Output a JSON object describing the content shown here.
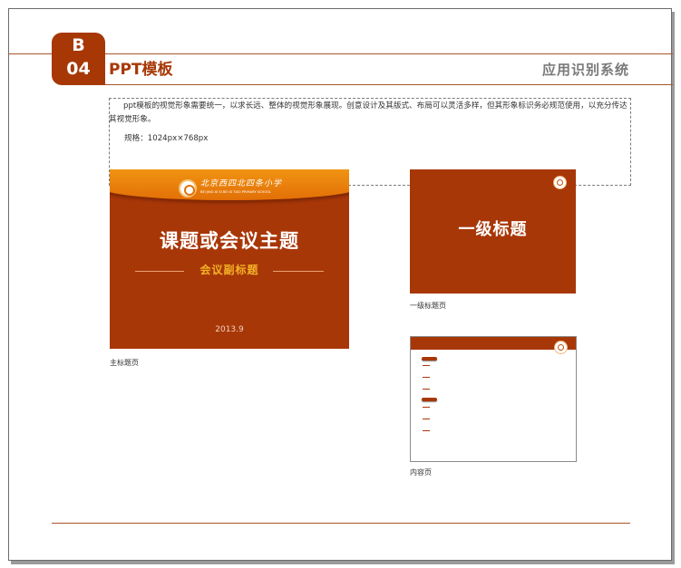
{
  "header": {
    "badge_letter": "B",
    "badge_number": "04",
    "section_title": "PPT模板",
    "system_name": "应用识别系统"
  },
  "description": {
    "text": "ppt模板的视觉形象需要统一，以求长远、整体的视觉形象展现。创意设计及其版式、布局可以灵活多样，但其形象标识务必规范使用，以充分传达其视觉形象。",
    "spec": "规格：1024px×768px"
  },
  "slides": {
    "main": {
      "school_name_cn": "北京西四北四条小学",
      "school_name_en": "BEI JING XI SI BEI SI TIAO PRIMARY SCHOOL",
      "title": "课题或会议主题",
      "subtitle": "会议副标题",
      "date": "2013.9",
      "caption": "主标题页"
    },
    "level1": {
      "title": "一级标题",
      "caption": "一级标题页"
    },
    "content": {
      "caption": "内容页"
    }
  },
  "colors": {
    "brand_red": "#a83708",
    "brand_orange": "#f39a14",
    "subtitle_yellow": "#f3b126",
    "rule_line": "#a9542a",
    "system_gray": "#7a7a7a"
  }
}
